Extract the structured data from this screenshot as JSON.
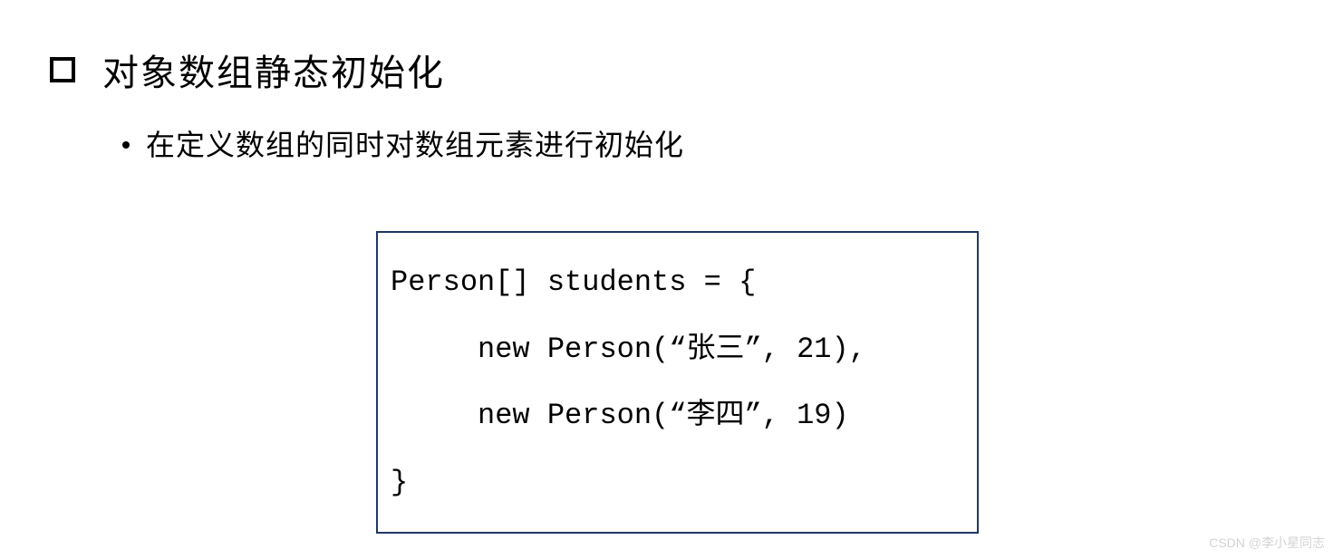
{
  "heading": "对象数组静态初始化",
  "subheading": "在定义数组的同时对数组元素进行初始化",
  "code": {
    "line1": "Person[] students = {",
    "line2": "     new Person(“张三”, 21),",
    "line3": "     new Person(“李四”, 19)",
    "line4": "}"
  },
  "watermark": "CSDN @李小星同志"
}
